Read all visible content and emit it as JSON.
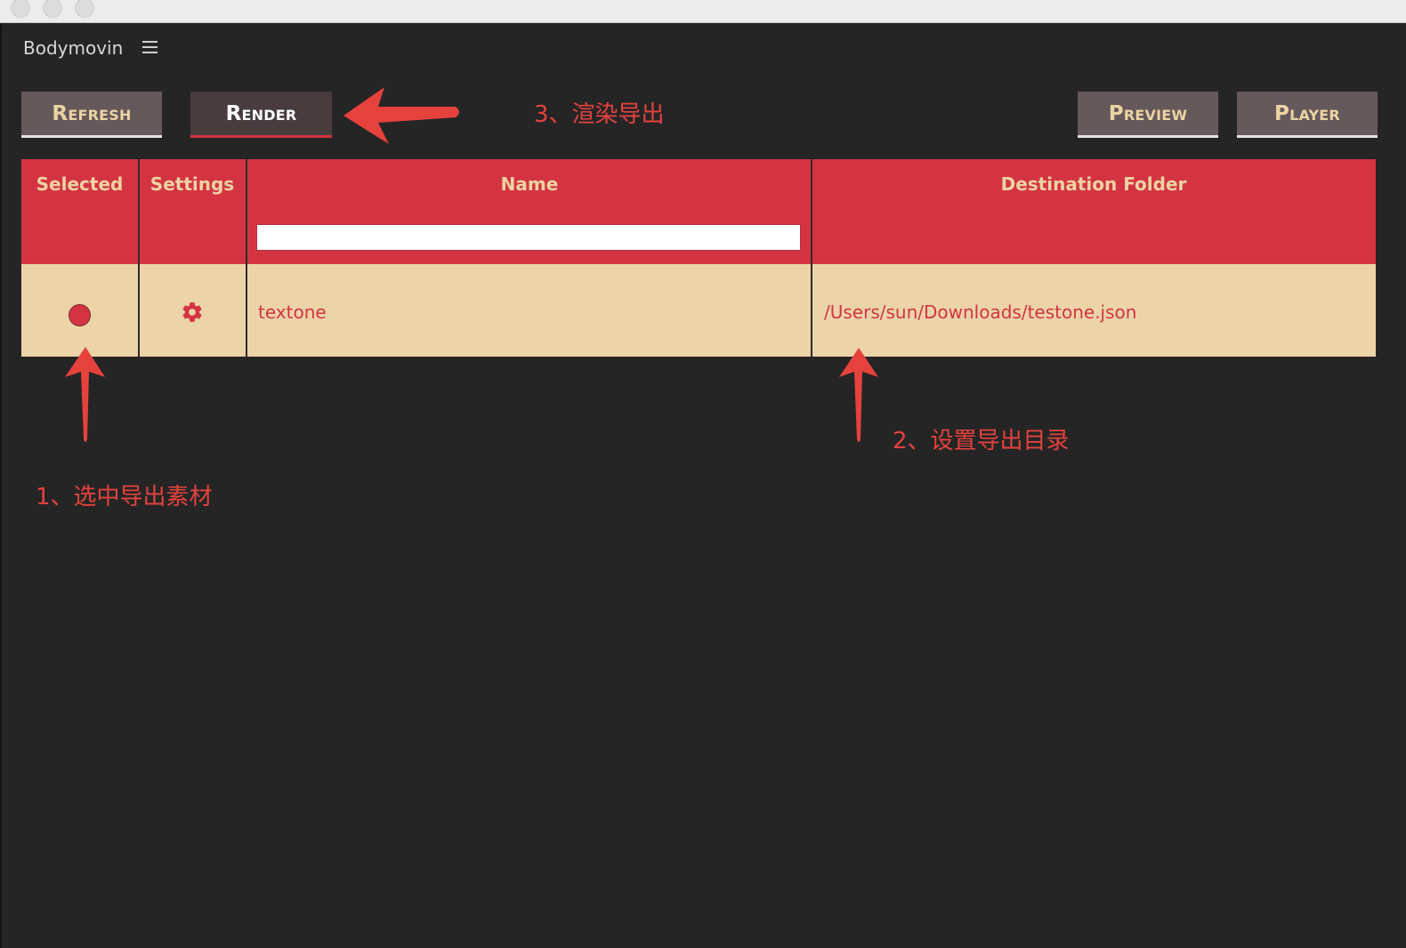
{
  "app": {
    "title": "Bodymovin"
  },
  "toolbar": {
    "refresh_label": "Refresh",
    "render_label": "Render",
    "preview_label": "Preview",
    "player_label": "Player"
  },
  "table": {
    "columns": [
      "Selected",
      "Settings",
      "Name",
      "Destination Folder"
    ],
    "rows": [
      {
        "name": "textone",
        "destination": "/Users/sun/Downloads/testone.json"
      }
    ]
  },
  "annotations": {
    "step1": "1、选中导出素材",
    "step2": "2、设置导出目录",
    "step3": "3、渲染导出"
  },
  "colors": {
    "background": "#252525",
    "header_red": "#d43442",
    "row_beige": "#ecd4a8",
    "button_gray": "#66595c",
    "annotation_red": "#e5423e"
  },
  "icons": [
    "menu-icon",
    "gear-icon",
    "radio-selected-icon",
    "arrow-annotation"
  ]
}
